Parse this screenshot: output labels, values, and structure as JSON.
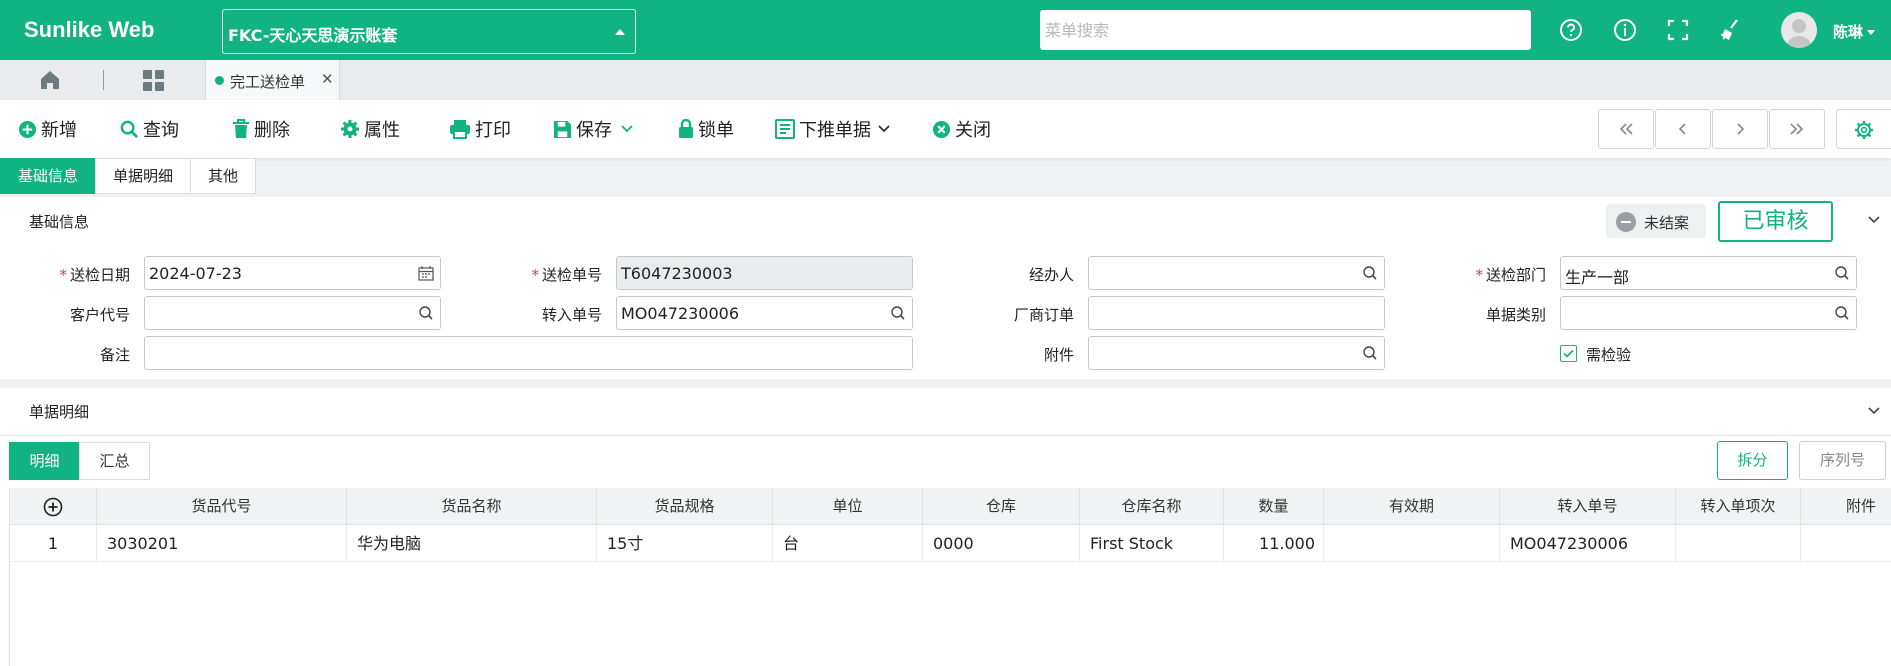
{
  "header": {
    "logo": "Sunlike Web",
    "account": "FKC-天心天思演示账套",
    "search_placeholder": "菜单搜索",
    "user_name": "陈琳"
  },
  "tabs": {
    "doc_tab": "完工送检单"
  },
  "toolbar": {
    "new": "新增",
    "query": "查询",
    "delete": "删除",
    "properties": "属性",
    "print": "打印",
    "save": "保存",
    "lock": "锁单",
    "push_down": "下推单据",
    "close": "关闭"
  },
  "section_tabs": [
    "基础信息",
    "单据明细",
    "其他"
  ],
  "basic": {
    "title": "基础信息",
    "status": "未结案",
    "approved": "已审核",
    "fields": {
      "inspect_date_label": "送检日期",
      "inspect_date": "2024-07-23",
      "inspect_no_label": "送检单号",
      "inspect_no": "T6047230003",
      "handler_label": "经办人",
      "handler": "",
      "dept_label": "送检部门",
      "dept": "生产一部",
      "customer_label": "客户代号",
      "customer": "",
      "transfer_no_label": "转入单号",
      "transfer_no": "MO047230006",
      "vendor_order_label": "厂商订单",
      "vendor_order": "",
      "doc_type_label": "单据类别",
      "doc_type": "",
      "remark_label": "备注",
      "remark": "",
      "attachment_label": "附件",
      "attachment": "",
      "need_inspect_label": "需检验",
      "need_inspect_checked": true
    }
  },
  "detail": {
    "title": "单据明细",
    "subtabs": [
      "明细",
      "汇总"
    ],
    "split_button": "拆分",
    "serial_button": "序列号",
    "columns": [
      "货品代号",
      "货品名称",
      "货品规格",
      "单位",
      "仓库",
      "仓库名称",
      "数量",
      "有效期",
      "转入单号",
      "转入单项次",
      "附件"
    ],
    "rows": [
      {
        "no": "1",
        "code": "3030201",
        "name": "华为电脑",
        "spec": "15寸",
        "unit": "台",
        "warehouse": "0000",
        "warehouse_name": "First Stock",
        "qty": "11.000",
        "expiry": "",
        "transfer_no": "MO047230006",
        "transfer_seq": "",
        "attachment": ""
      }
    ]
  },
  "colors": {
    "brand": "#11b382",
    "required": "#e23b3b"
  }
}
